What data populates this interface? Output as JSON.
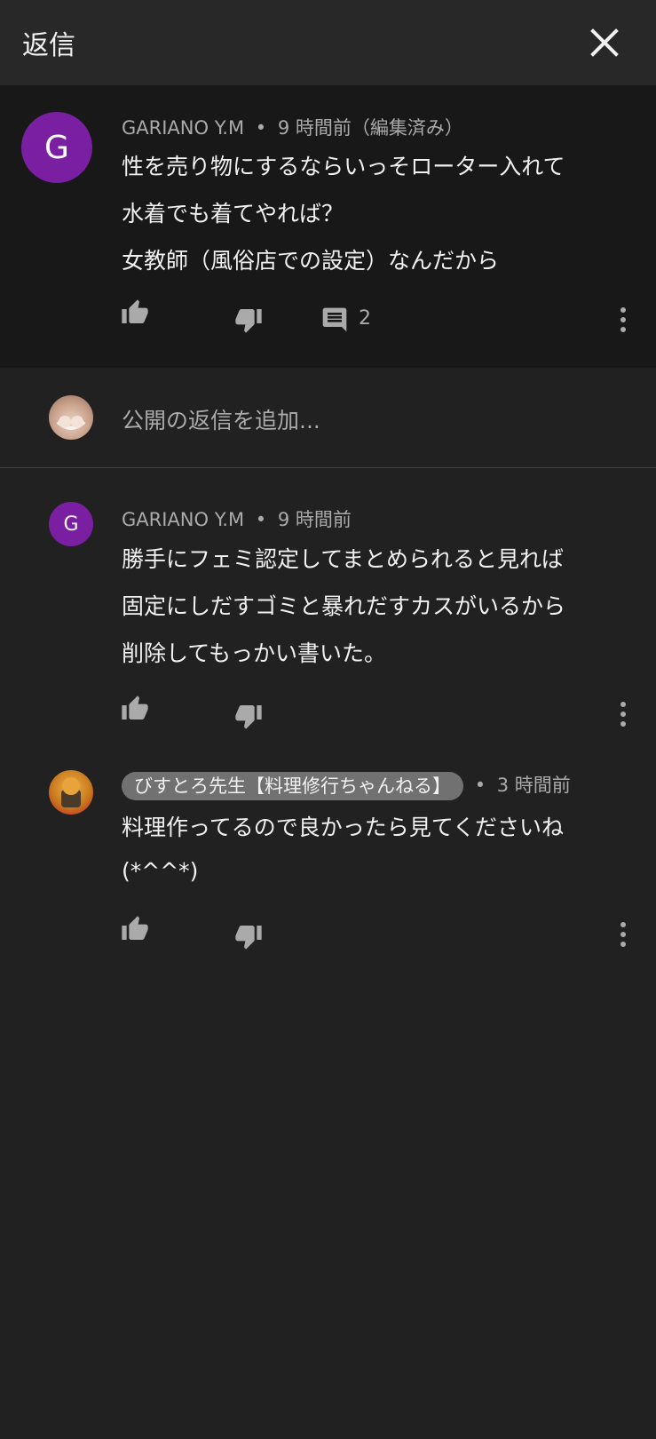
{
  "header": {
    "title": "返信"
  },
  "parent_comment": {
    "avatar_letter": "G",
    "author": "GARIANO Y.M",
    "separator": "•",
    "time": "9 時間前（編集済み）",
    "lines": [
      "性を売り物にするならいっそローター入れて",
      "水着でも着てやれば？",
      "女教師（風俗店での設定）なんだから"
    ],
    "reply_count": "2",
    "colors": {
      "avatar": "#7b1fa2",
      "background": "#181818"
    }
  },
  "add_reply": {
    "placeholder": "公開の返信を追加..."
  },
  "replies": [
    {
      "avatar_letter": "G",
      "author": "GARIANO Y.M",
      "separator": "•",
      "time": "9 時間前",
      "lines": [
        "勝手にフェミ認定してまとめられると見れば",
        "固定にしだすゴミと暴れだすカスがいるから",
        "削除してもっかい書いた。"
      ]
    },
    {
      "author": "びすとろ先生【料理修行ちゃんねる】",
      "separator": "•",
      "time": "3 時間前",
      "lines": [
        "料理作ってるので良かったら見てくださいね",
        "(*^^*)"
      ]
    }
  ],
  "icons": [
    "close-icon",
    "thumbs-up-icon",
    "thumbs-down-icon",
    "comment-icon",
    "more-vert-icon"
  ]
}
